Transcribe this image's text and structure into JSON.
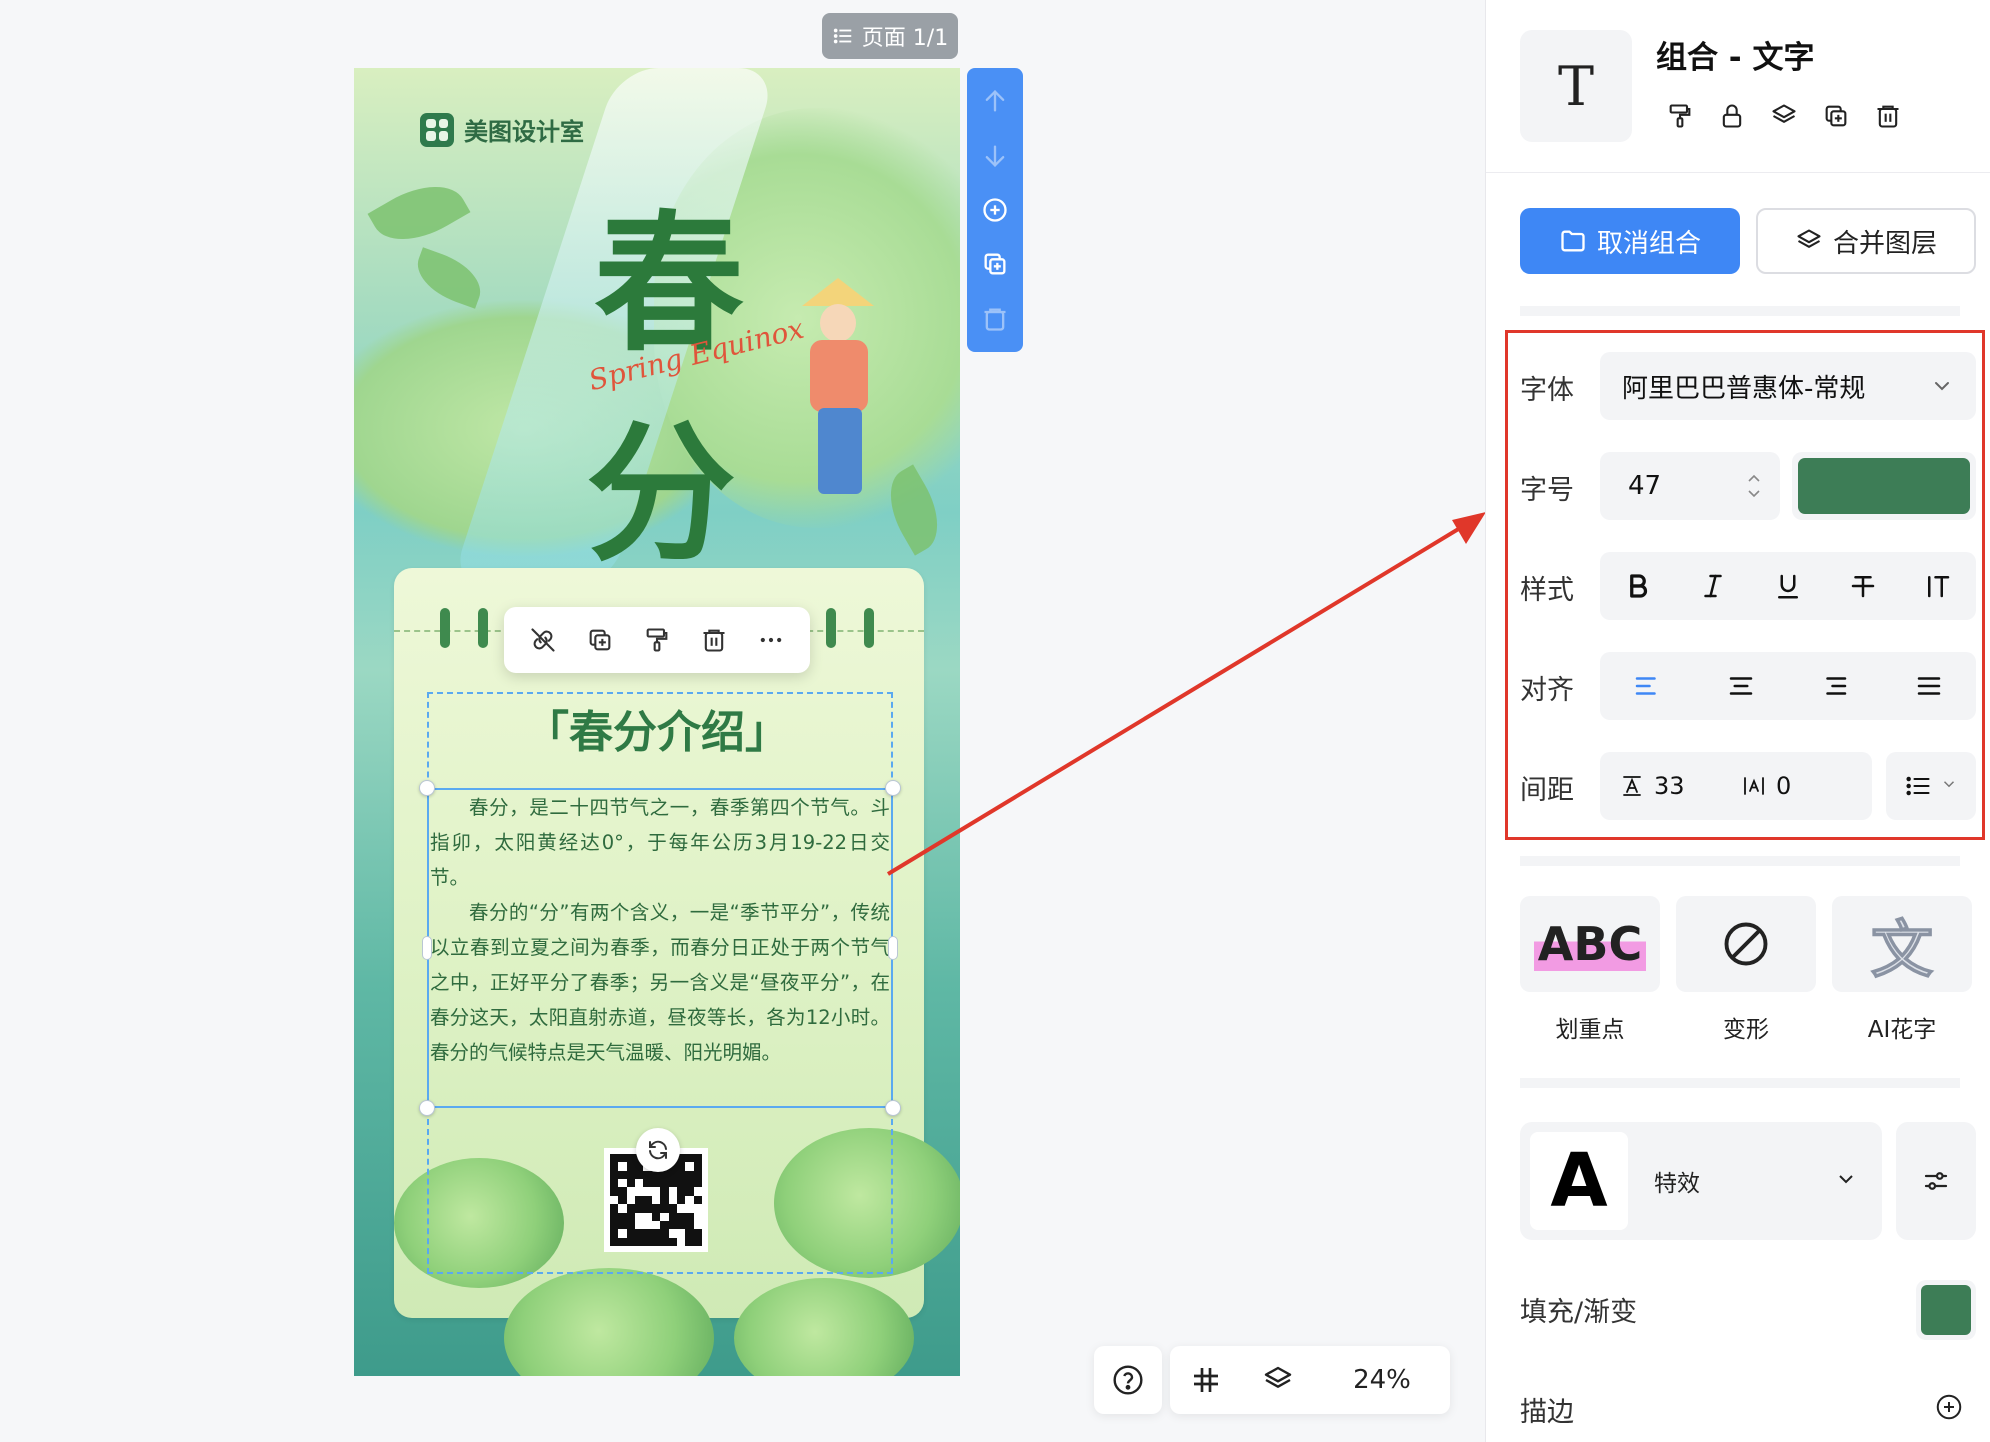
{
  "canvas": {
    "page_indicator": "页面 1/1",
    "zoom": "24%"
  },
  "poster": {
    "brand": "美图设计室",
    "title_chars": [
      "春",
      "分"
    ],
    "script_text": "Spring Equinox",
    "intro_title": "「春分介绍」",
    "intro_paragraphs": [
      "春分，是二十四节气之一，春季第四个节气。斗指卯，太阳黄经达0°，于每年公历3月19-22日交节。",
      "春分的“分”有两个含义，一是“季节平分”，传统以立春到立夏之间为春季，而春分日正处于两个节气之中，正好平分了春季；另一含义是“昼夜平分”，在春分这天，太阳直射赤道，昼夜等长，各为12小时。春分的气候特点是天气温暖、阳光明媚。"
    ]
  },
  "float_toolbar": [
    "unlink-icon",
    "duplicate-icon",
    "format-painter-icon",
    "trash-icon",
    "more-icon"
  ],
  "side_toolbar": [
    "move-up-icon",
    "move-down-icon",
    "add-page-icon",
    "copy-page-icon",
    "delete-page-icon"
  ],
  "panel": {
    "object_icon_text": "T",
    "object_title": "组合 - 文字",
    "ungroup_label": "取消组合",
    "merge_label": "合并图层",
    "font_label": "字体",
    "font_value": "阿里巴巴普惠体-常规",
    "size_label": "字号",
    "size_value": "47",
    "style_label": "样式",
    "align_label": "对齐",
    "spacing_label": "间距",
    "line_spacing": "33",
    "letter_spacing": "0",
    "effects": [
      {
        "label": "划重点",
        "preview": "ABC"
      },
      {
        "label": "变形",
        "preview": ""
      },
      {
        "label": "AI花字",
        "preview": "文"
      }
    ],
    "fx_preview": "A",
    "fx_label": "特效",
    "fill_label": "填充/渐变",
    "stroke_label": "描边",
    "colors": {
      "text_color": "#3d7d56",
      "accent": "#3e87f5",
      "highlight": "#e0372a"
    }
  }
}
